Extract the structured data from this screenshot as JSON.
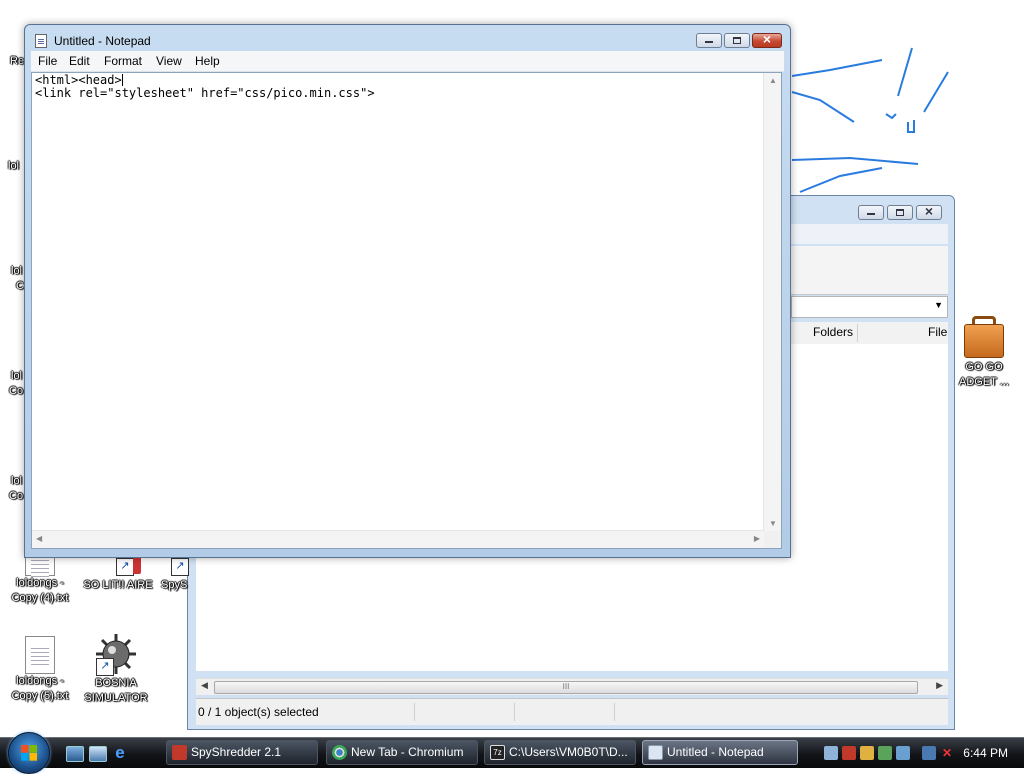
{
  "desktop": {
    "icons": [
      {
        "label_line1": "loldongs -",
        "label_line2": "Copy (4).txt"
      },
      {
        "label_line1": "SO LIT!! AIRE",
        "label_line2": ""
      },
      {
        "label_line1": "loldongs -",
        "label_line2": "Copy (5).txt"
      },
      {
        "label_line1": "BOSNIA",
        "label_line2": "SIMULATOR"
      },
      {
        "label_line1": "GO GO",
        "label_line2": "ADGET ..."
      }
    ],
    "partial_labels": [
      "Re",
      "lol",
      "lol",
      "C",
      "lol",
      "Co",
      "lol",
      "Co",
      "SpyS"
    ]
  },
  "notepad": {
    "title": "Untitled - Notepad",
    "menu": [
      "File",
      "Edit",
      "Format",
      "View",
      "Help"
    ],
    "line1": "<html><head>",
    "line2": "<link rel=\"stylesheet\" href=\"css/pico.min.css\">"
  },
  "explorer": {
    "tab_folders": "Folders",
    "tab_file": "File",
    "status_text": "0 / 1 object(s) selected",
    "scroll_grip": "III"
  },
  "taskbar": {
    "items": [
      {
        "label": "SpyShredder 2.1",
        "color": "#c0392b"
      },
      {
        "label": "New Tab - Chromium",
        "color": "#3b82c4"
      },
      {
        "label": "C:\\Users\\VM0B0T\\D...",
        "color": "#222222"
      },
      {
        "label": "Untitled - Notepad",
        "color": "#dce6f3"
      }
    ],
    "clock": "6:44 PM"
  },
  "colors": {
    "scribble": "#2a7be0"
  }
}
